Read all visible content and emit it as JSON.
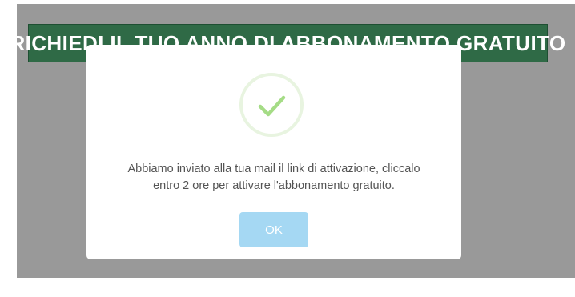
{
  "page": {
    "cta_label": "RICHIEDI IL TUO ANNO DI ABBONAMENTO GRATUITO"
  },
  "modal": {
    "icon": "success-check-icon",
    "message_line1": "Abbiamo inviato alla tua mail il link di attivazione, cliccalo",
    "message_line2": "entro 2 ore per attivare l'abbonamento gratuito.",
    "ok_label": "OK"
  },
  "colors": {
    "overlay": "#999999",
    "cta_background": "#2f6a46",
    "check_stroke": "#a5dc86",
    "ok_button": "#a5d8f3"
  }
}
